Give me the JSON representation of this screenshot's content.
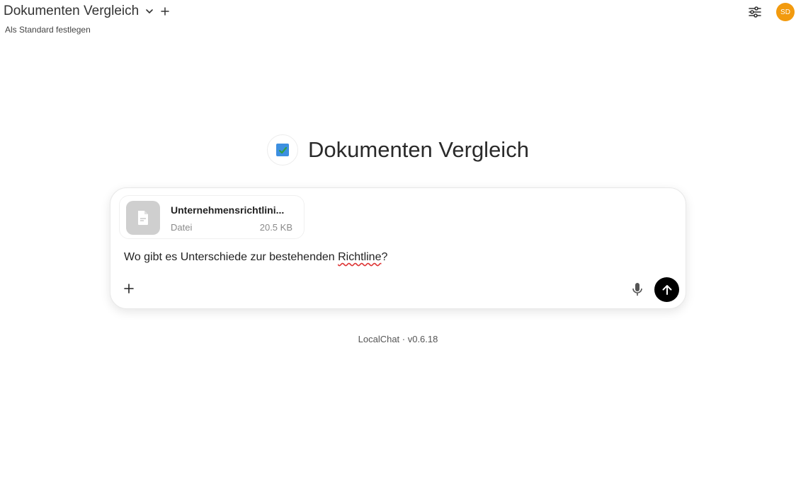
{
  "header": {
    "model_name": "Dokumenten Vergleich",
    "set_default_label": "Als Standard festlegen",
    "user_initials": "SD"
  },
  "hero": {
    "title": "Dokumenten Vergleich"
  },
  "composer": {
    "attachment": {
      "name": "Unternehmensrichtlini...",
      "type": "Datei",
      "size": "20.5 KB"
    },
    "message_before": "Wo gibt es Unterschiede zur bestehenden ",
    "message_misspelled": "Richtline",
    "message_after": "?"
  },
  "footer": {
    "version_text": "LocalChat · v0.6.18"
  },
  "colors": {
    "avatar_bg": "#f29a0e",
    "send_bg": "#000000",
    "logo_blue": "#3d8fe0",
    "logo_check": "#2ea043"
  },
  "icons": [
    "chevron-down-icon",
    "plus-icon",
    "sliders-icon",
    "file-icon",
    "microphone-icon",
    "arrow-up-icon"
  ]
}
